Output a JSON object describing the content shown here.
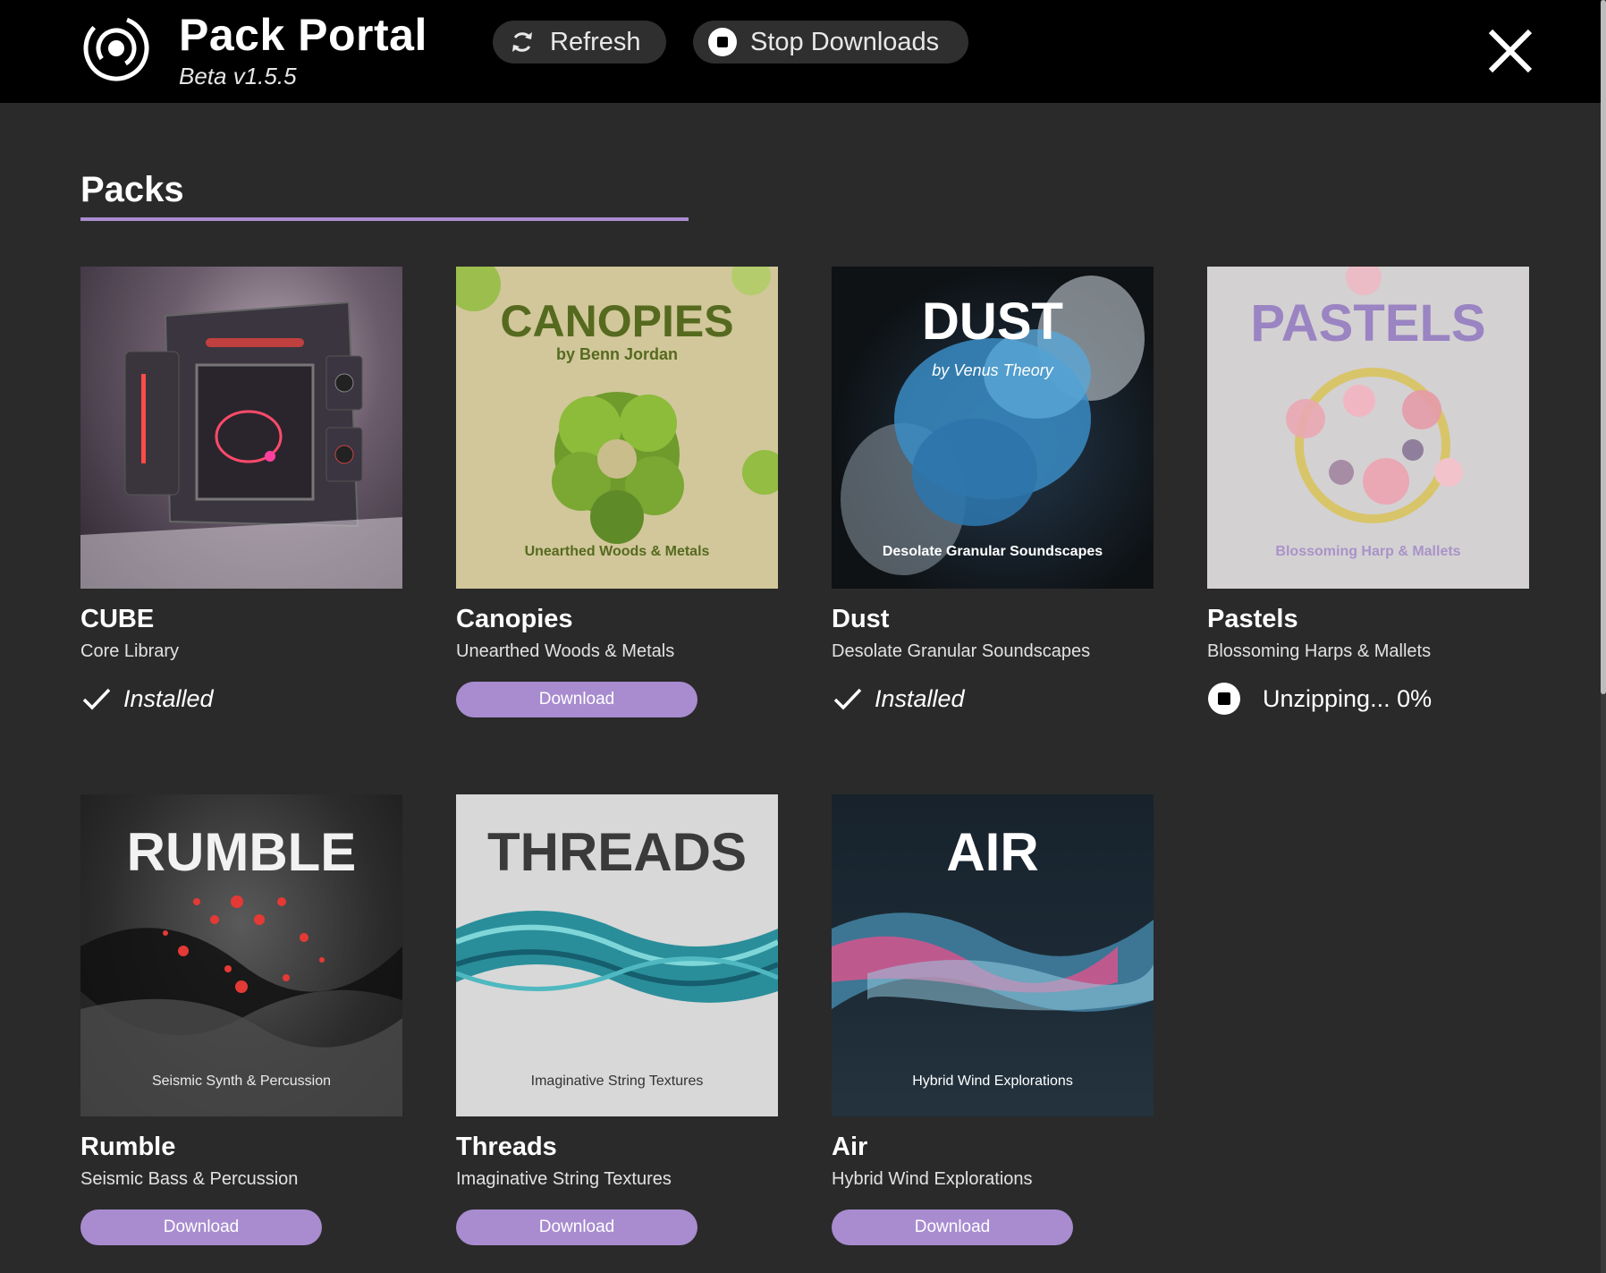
{
  "header": {
    "title": "Pack Portal",
    "version": "Beta v1.5.5",
    "refresh_label": "Refresh",
    "stop_label": "Stop Downloads",
    "icons": {
      "logo": "portal-logo-icon",
      "refresh": "refresh-icon",
      "stop": "stop-icon",
      "close": "close-icon"
    }
  },
  "section": {
    "title": "Packs"
  },
  "colors": {
    "accent": "#a88ccf",
    "background": "#2a2a2a",
    "header": "#000000"
  },
  "packs": [
    {
      "name": "CUBE",
      "description": "Core Library",
      "status": "installed",
      "status_label": "Installed",
      "cover": {
        "title": "",
        "byline": "",
        "subtitle": ""
      }
    },
    {
      "name": "Canopies",
      "description": "Unearthed Woods & Metals",
      "status": "download",
      "status_label": "Download",
      "cover": {
        "title": "CANOPIES",
        "byline": "by Benn Jordan",
        "subtitle": "Unearthed Woods & Metals"
      }
    },
    {
      "name": "Dust",
      "description": "Desolate Granular Soundscapes",
      "status": "installed",
      "status_label": "Installed",
      "cover": {
        "title": "DUST",
        "byline": "by Venus Theory",
        "subtitle": "Desolate Granular Soundscapes"
      }
    },
    {
      "name": "Pastels",
      "description": "Blossoming Harps & Mallets",
      "status": "unzipping",
      "status_label": "Unzipping... 0%",
      "progress": 0,
      "cover": {
        "title": "PASTELS",
        "byline": "",
        "subtitle": "Blossoming Harp & Mallets"
      }
    },
    {
      "name": "Rumble",
      "description": "Seismic Bass & Percussion",
      "status": "download",
      "status_label": "Download",
      "cover": {
        "title": "RUMBLE",
        "byline": "",
        "subtitle": "Seismic Synth & Percussion"
      }
    },
    {
      "name": "Threads",
      "description": "Imaginative String Textures",
      "status": "download",
      "status_label": "Download",
      "cover": {
        "title": "THREADS",
        "byline": "",
        "subtitle": "Imaginative String Textures"
      }
    },
    {
      "name": "Air",
      "description": "Hybrid Wind Explorations",
      "status": "download",
      "status_label": "Download",
      "cover": {
        "title": "AIR",
        "byline": "",
        "subtitle": "Hybrid Wind Explorations"
      }
    }
  ]
}
